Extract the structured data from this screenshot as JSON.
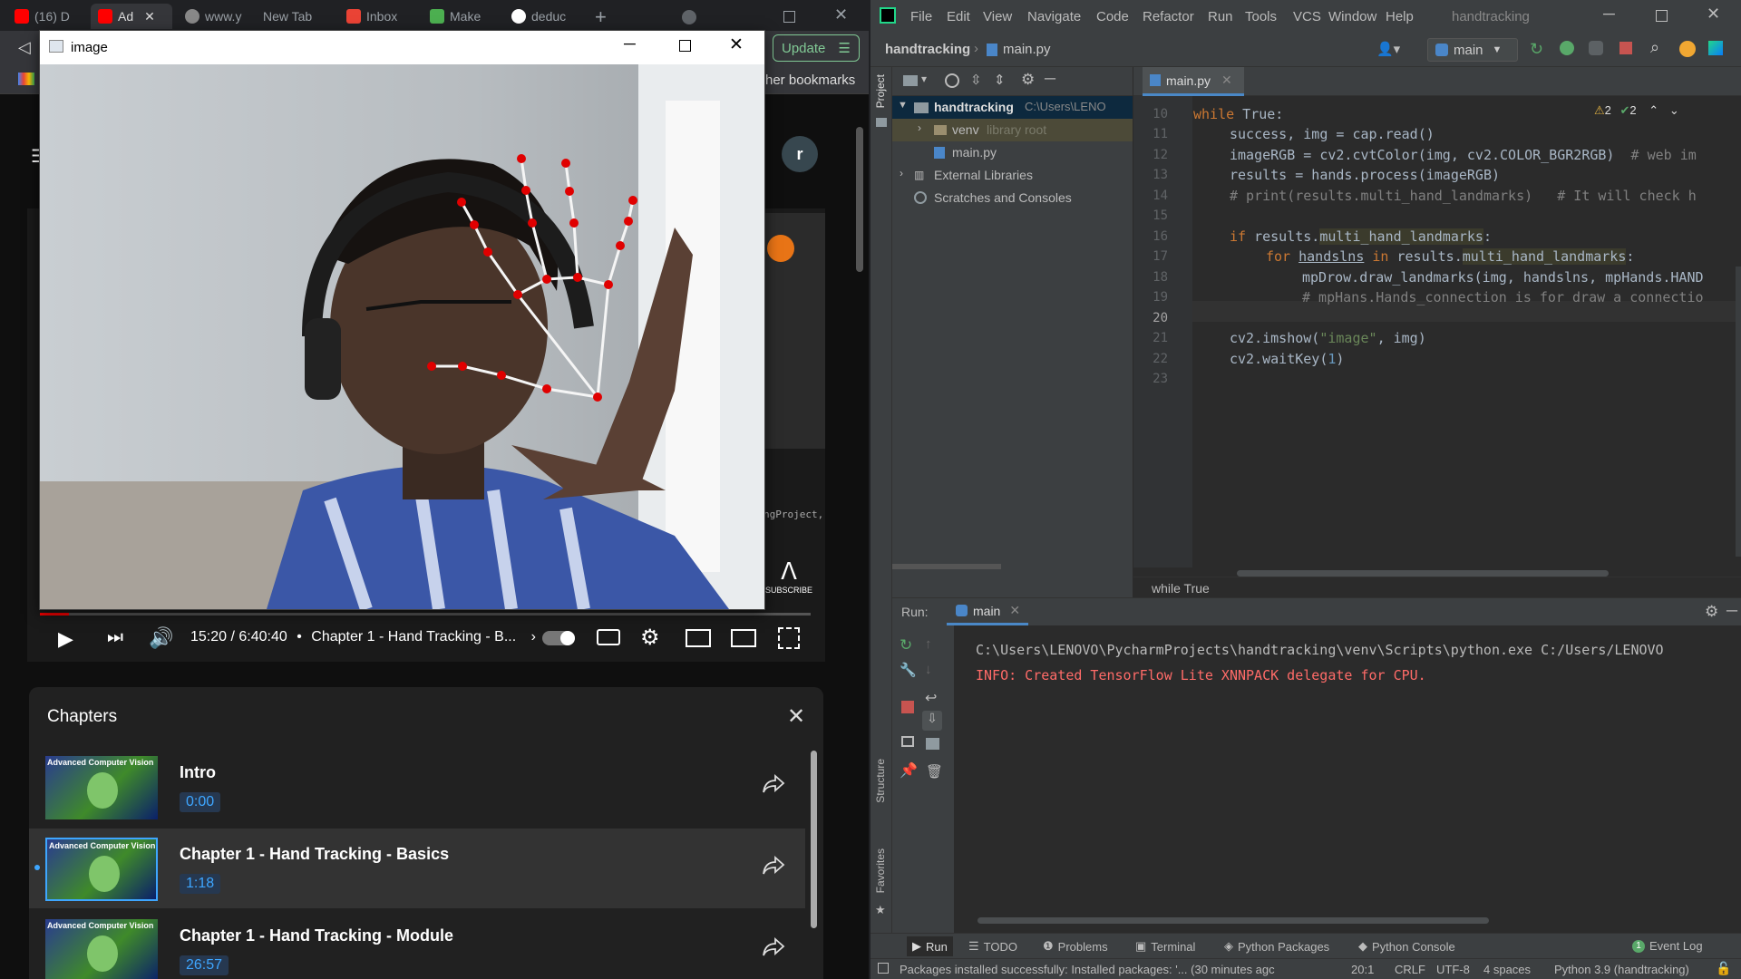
{
  "chrome": {
    "tabs": [
      {
        "label": "(16) D"
      },
      {
        "label": "Ad"
      },
      {
        "label": "www.y"
      },
      {
        "label": "New Tab"
      },
      {
        "label": "Inbox"
      },
      {
        "label": "Make"
      },
      {
        "label": "deduc"
      }
    ],
    "update_label": "Update",
    "bookmarks_label": "her bookmarks",
    "avatar_letter": "r"
  },
  "player": {
    "time": "15:20 / 6:40:40",
    "separator": "•",
    "chapter": "Chapter 1 - Hand Tracking - B...",
    "progress": 0.038,
    "subscribe_label": "SUBSCRIBE",
    "partial_code": "ngProject,"
  },
  "chapters": {
    "title": "Chapters",
    "thumb_text": "Advanced Computer Vision",
    "items": [
      {
        "title": "Intro",
        "time": "0:00"
      },
      {
        "title": "Chapter 1 - Hand Tracking - Basics",
        "time": "1:18"
      },
      {
        "title": "Chapter 1 - Hand Tracking - Module",
        "time": "26:57"
      }
    ]
  },
  "image_window": {
    "title": "image"
  },
  "pycharm": {
    "menu": [
      "File",
      "Edit",
      "View",
      "Navigate",
      "Code",
      "Refactor",
      "Run",
      "Tools",
      "VCS",
      "Window",
      "Help"
    ],
    "window_title": "handtracking",
    "breadcrumb": {
      "project": "handtracking",
      "file": "main.py"
    },
    "run_config": "main",
    "project_tab": "Project",
    "tree": {
      "root": "handtracking",
      "root_path": "C:\\Users\\LENO",
      "venv": "venv",
      "venv_note": "library root",
      "main": "main.py",
      "ext": "External Libraries",
      "scratch": "Scratches and Consoles"
    },
    "editor_tab": "main.py",
    "warnings": "2",
    "checks": "2",
    "line_numbers": [
      "10",
      "11",
      "12",
      "13",
      "14",
      "15",
      "16",
      "17",
      "18",
      "19",
      "20",
      "21",
      "22",
      "23"
    ],
    "code": {
      "l10_kw": "while",
      "l10_rest": " True:",
      "l11": "success, img = cap.read()",
      "l12": "imageRGB = cv2.cvtColor(img, cv2.COLOR_BGR2RGB)",
      "l12_cm": "# web im",
      "l13": "results = hands.process(imageRGB)",
      "l14": "# print(results.multi_hand_landmarks)   # It will check h",
      "l16_kw": "if",
      "l16_a": " results.",
      "l16_b": "multi_hand_landmarks",
      "l16_c": ":",
      "l17_kw": "for",
      "l17_a": "handslns",
      "l17_kw2": "in",
      "l17_b": " results.",
      "l17_c": "multi_hand_landmarks",
      "l17_d": ":",
      "l18": "mpDrow.draw_landmarks(img, handslns, mpHands.HAND",
      "l19": "# mpHans.Hands_connection is for draw a connectio",
      "l21_a": "cv2.imshow(",
      "l21_str": "\"image\"",
      "l21_b": ", img)",
      "l22_a": "cv2.waitKey(",
      "l22_num": "1",
      "l22_b": ")"
    },
    "code_crumb": "while True",
    "run": {
      "label": "Run:",
      "config": "main",
      "line1": "C:\\Users\\LENOVO\\PycharmProjects\\handtracking\\venv\\Scripts\\python.exe C:/Users/LENOVO",
      "line2": "INFO: Created TensorFlow Lite XNNPACK delegate for CPU."
    },
    "side_labels": {
      "structure": "Structure",
      "favorites": "Favorites"
    },
    "bottom_tabs": [
      "Run",
      "TODO",
      "Problems",
      "Terminal",
      "Python Packages",
      "Python Console"
    ],
    "event_log": "Event Log",
    "event_count": "1",
    "status": {
      "message": "Packages installed successfully: Installed packages: '... (30 minutes agc",
      "position": "20:1",
      "line_sep": "CRLF",
      "encoding": "UTF-8",
      "indent": "4 spaces",
      "interpreter": "Python 3.9 (handtracking)"
    }
  },
  "colors": {
    "accent_red": "#ff0000",
    "yt_blue": "#3ea6ff",
    "pycharm_bg": "#2b2b2b"
  }
}
